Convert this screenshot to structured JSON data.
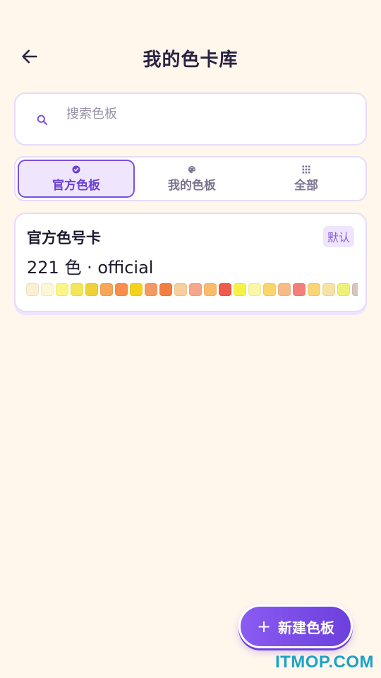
{
  "header": {
    "title": "我的色卡库",
    "back_icon": "arrow-left-icon"
  },
  "search": {
    "placeholder": "搜索色板",
    "value": ""
  },
  "tabs": [
    {
      "label": "官方色板",
      "icon": "verified-badge-icon",
      "active": true
    },
    {
      "label": "我的色板",
      "icon": "palette-icon",
      "active": false
    },
    {
      "label": "全部",
      "icon": "grid-dots-icon",
      "active": false
    }
  ],
  "card": {
    "title": "官方色号卡",
    "badge": "默认",
    "meta": "221 色 · official",
    "swatches": [
      "#fbeed2",
      "#fdf7d6",
      "#fbf585",
      "#f5e55a",
      "#efd13a",
      "#f7a557",
      "#f88d4d",
      "#f4d21c",
      "#f39a63",
      "#f27e3f",
      "#f8cf9a",
      "#f6a68a",
      "#f9bc6b",
      "#ef5a4b",
      "#f6f145",
      "#faf7a6",
      "#fbd56b",
      "#f8ba86",
      "#f47f7a",
      "#f9d577",
      "#f6e2a4",
      "#eef177",
      "#d4c8be"
    ]
  },
  "fab": {
    "plus": "+",
    "label": "新建色板"
  },
  "watermark": "ITMOP.COM",
  "colors": {
    "accent": "#7b4fe0",
    "background": "#fff6ec"
  }
}
